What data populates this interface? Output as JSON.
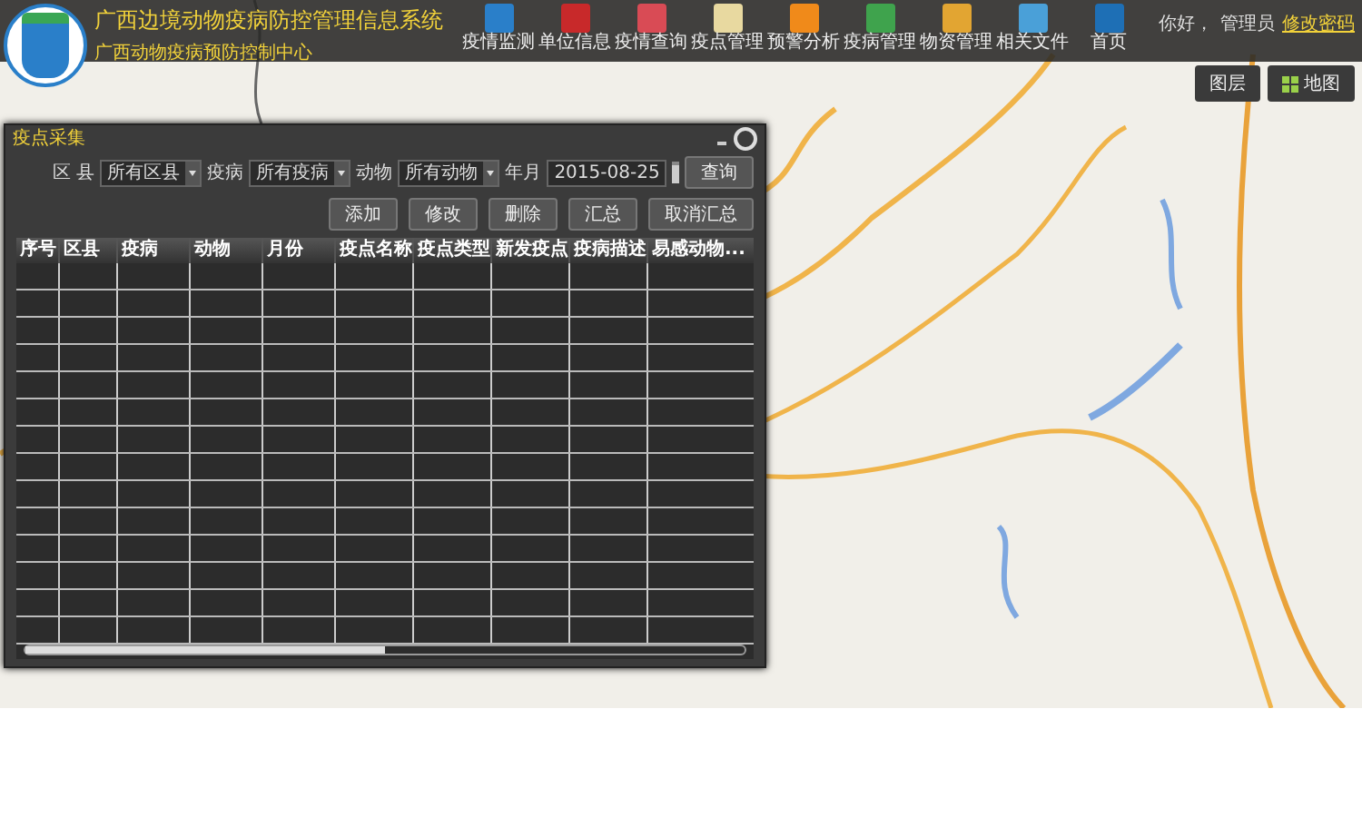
{
  "header": {
    "title": "广西边境动物疫病防控管理信息系统",
    "subtitle": "广西动物疫病预防控制中心",
    "toolbar": [
      {
        "label": "疫情监测"
      },
      {
        "label": "单位信息"
      },
      {
        "label": "疫情查询"
      },
      {
        "label": "疫点管理"
      },
      {
        "label": "预警分析"
      },
      {
        "label": "疫病管理"
      },
      {
        "label": "物资管理"
      },
      {
        "label": "相关文件"
      },
      {
        "label": "首页"
      }
    ],
    "greeting": "你好，",
    "user": "管理员",
    "link": "修改密码"
  },
  "map": {
    "buttons": [
      {
        "label": "图层",
        "kind": "plain"
      },
      {
        "label": "地图",
        "kind": "grid"
      }
    ]
  },
  "dialog": {
    "title": "疫点采集",
    "filters": [
      {
        "label": "区 县",
        "value": "所有区县",
        "kind": "select"
      },
      {
        "label": "疫病",
        "value": "所有疫病",
        "kind": "select"
      },
      {
        "label": "动物",
        "value": "所有动物",
        "kind": "select"
      },
      {
        "label": "年月",
        "value": "2015-08-25",
        "kind": "date"
      }
    ],
    "search_button": "查询",
    "actions": [
      "添加",
      "修改",
      "删除",
      "汇总",
      "取消汇总"
    ],
    "columns": [
      "序号",
      "区县",
      "疫病",
      "动物",
      "月份",
      "疫点名称",
      "疫点类型",
      "新发疫点",
      "疫病描述",
      "易感动物..."
    ]
  }
}
